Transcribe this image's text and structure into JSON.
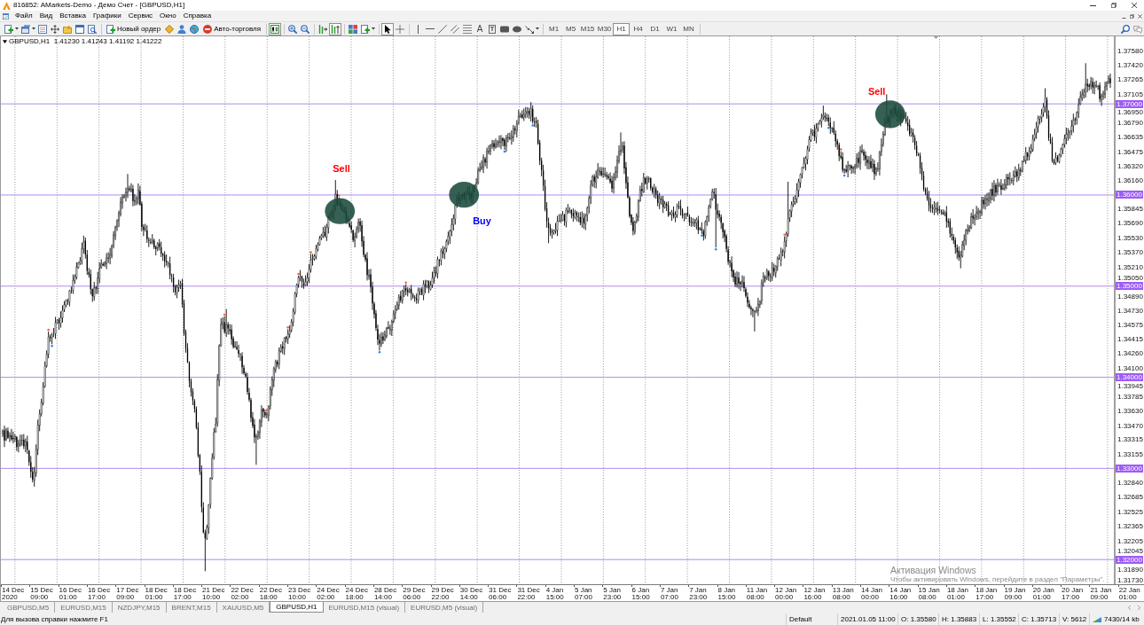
{
  "window": {
    "title": "816852: AMarkets-Demo - Демо Счет - [GBPUSD,H1]"
  },
  "menu": [
    "Файл",
    "Вид",
    "Вставка",
    "Графики",
    "Сервис",
    "Окно",
    "Справка"
  ],
  "toolbar": {
    "order_button": "Новый ордер",
    "autotrading_button": "Авто-торговля",
    "tool_buttons": [
      {
        "pressed": true
      },
      {
        "pressed": false
      },
      {
        "pressed": false
      },
      {
        "pressed": false
      },
      {
        "pressed": true
      },
      {
        "pressed": false
      },
      {
        "pressed": false
      },
      {
        "pressed": true
      },
      {
        "pressed": false
      }
    ],
    "text_tool": "A",
    "label_tool": "T",
    "periods": [
      {
        "label": "M1",
        "selected": false
      },
      {
        "label": "M5",
        "selected": false
      },
      {
        "label": "M15",
        "selected": false
      },
      {
        "label": "M30",
        "selected": false
      },
      {
        "label": "H1",
        "selected": true
      },
      {
        "label": "H4",
        "selected": false
      },
      {
        "label": "D1",
        "selected": false
      },
      {
        "label": "W1",
        "selected": false
      },
      {
        "label": "MN",
        "selected": false
      }
    ]
  },
  "chart": {
    "header": {
      "symbol": "GBPUSD,H1",
      "prices": [
        "1.41230",
        "1.41243",
        "1.41192",
        "1.41222"
      ]
    },
    "annotations": [
      {
        "text": "Sell",
        "color": "#ff0000"
      },
      {
        "text": "Buy",
        "color": "#0000ff"
      },
      {
        "text": "Sell",
        "color": "#ff0000"
      }
    ],
    "price_ticks": [
      "1.37580",
      "1.37420",
      "1.37265",
      "1.37105",
      "1.36950",
      "1.36790",
      "1.36635",
      "1.36475",
      "1.36320",
      "1.36160",
      "1.35845",
      "1.35690",
      "1.35530",
      "1.35370",
      "1.35210",
      "1.35050",
      "1.34890",
      "1.34730",
      "1.34575",
      "1.34415",
      "1.34260",
      "1.34100",
      "1.33945",
      "1.33785",
      "1.33630",
      "1.33470",
      "1.33315",
      "1.33155",
      "1.32840",
      "1.32685",
      "1.32525",
      "1.32365",
      "1.32205",
      "1.32045",
      "1.31890",
      "1.31730"
    ],
    "levels": [
      "1.37000",
      "1.36000",
      "1.35000",
      "1.34000",
      "1.33000",
      "1.32000"
    ],
    "time_ticks": [
      "14 Dec 2020",
      "15 Dec 09:00",
      "16 Dec 01:00",
      "16 Dec 17:00",
      "17 Dec 09:00",
      "18 Dec 01:00",
      "18 Dec 17:00",
      "21 Dec 10:00",
      "22 Dec 02:00",
      "22 Dec 18:00",
      "23 Dec 10:00",
      "24 Dec 02:00",
      "24 Dec 18:00",
      "28 Dec 14:00",
      "29 Dec 06:00",
      "29 Dec 22:00",
      "30 Dec 14:00",
      "31 Dec 06:00",
      "31 Dec 22:00",
      "4 Jan 15:00",
      "5 Jan 07:00",
      "5 Jan 23:00",
      "6 Jan 15:00",
      "7 Jan 07:00",
      "7 Jan 23:00",
      "8 Jan 15:00",
      "11 Jan 08:00",
      "12 Jan 00:00",
      "12 Jan 16:00",
      "13 Jan 08:00",
      "14 Jan 00:00",
      "14 Jan 16:00",
      "15 Jan 08:00",
      "18 Jan 01:00",
      "18 Jan 17:00",
      "19 Jan 09:00",
      "20 Jan 01:00",
      "20 Jan 17:00",
      "21 Jan 09:00",
      "22 Jan 01:00"
    ],
    "activation_notice": {
      "title": "Активация Windows",
      "text": "Чтобы активировать Windows, перейдите в раздел \"Параметры\"."
    }
  },
  "chart_tabs": [
    {
      "label": "GBPUSD,M5",
      "selected": false
    },
    {
      "label": "EURUSD,M15",
      "selected": false
    },
    {
      "label": "NZDJPY,M15",
      "selected": false
    },
    {
      "label": "BRENT,M15",
      "selected": false
    },
    {
      "label": "XAUUSD,M5",
      "selected": false
    },
    {
      "label": "GBPUSD,H1",
      "selected": true
    },
    {
      "label": "EURUSD,M15 (visual)",
      "selected": false
    },
    {
      "label": "EURUSD,M5 (visual)",
      "selected": false
    }
  ],
  "status_bar": {
    "help": "Для вызова справки нажмите F1",
    "profile": "Default",
    "datetime": "2021.01.05 11:00",
    "open": "O: 1.35580",
    "high": "H: 1.35883",
    "low": "L: 1.35552",
    "close": "C: 1.35713",
    "volume": "V: 5612",
    "traffic": "7430/14 kb"
  }
}
